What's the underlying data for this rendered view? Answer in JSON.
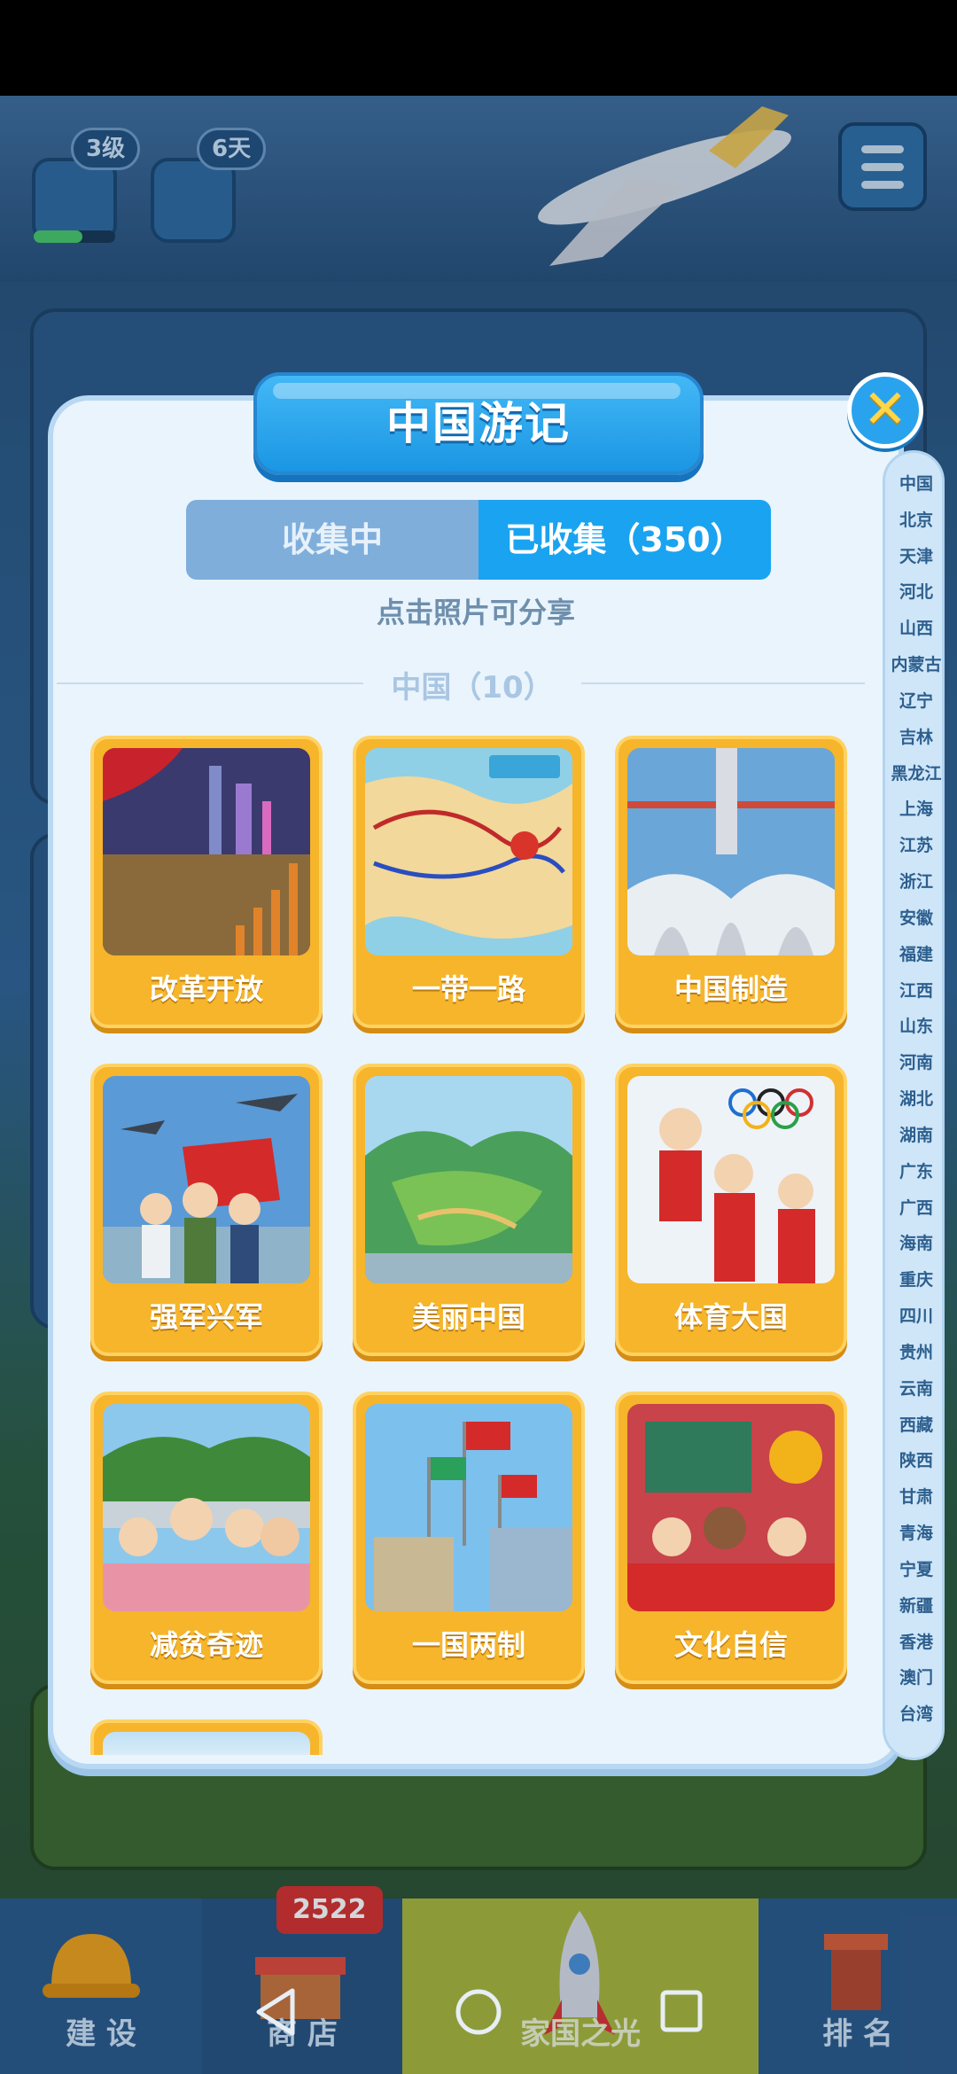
{
  "hud": {
    "level_badge": "3级",
    "days_badge": "6天"
  },
  "modal": {
    "title": "中国游记",
    "tabs": [
      {
        "label": "收集中",
        "active": false
      },
      {
        "label": "已收集（350）",
        "active": true
      }
    ],
    "share_hint": "点击照片可分享",
    "section_title": "中国（10）",
    "cards": [
      {
        "label": "改革开放"
      },
      {
        "label": "一带一路"
      },
      {
        "label": "中国制造"
      },
      {
        "label": "强军兴军"
      },
      {
        "label": "美丽中国"
      },
      {
        "label": "体育大国"
      },
      {
        "label": "减贫奇迹"
      },
      {
        "label": "一国两制"
      },
      {
        "label": "文化自信"
      }
    ]
  },
  "province_index": [
    "中国",
    "北京",
    "天津",
    "河北",
    "山西",
    "内蒙古",
    "辽宁",
    "吉林",
    "黑龙江",
    "上海",
    "江苏",
    "浙江",
    "安徽",
    "福建",
    "江西",
    "山东",
    "河南",
    "湖北",
    "湖南",
    "广东",
    "广西",
    "海南",
    "重庆",
    "四川",
    "贵州",
    "云南",
    "西藏",
    "陕西",
    "甘肃",
    "青海",
    "宁夏",
    "新疆",
    "香港",
    "澳门",
    "台湾"
  ],
  "bottom_nav": {
    "build": "建 设",
    "shop": "商 店",
    "shop_badge": "2522",
    "home": "家国之光",
    "rank": "排 名"
  },
  "colors": {
    "accent_blue": "#1aa3f0",
    "card_orange": "#f6b52b",
    "panel_bg": "#eaf4fd"
  }
}
